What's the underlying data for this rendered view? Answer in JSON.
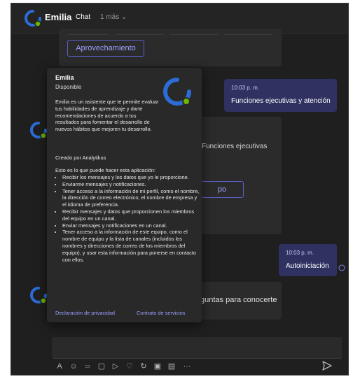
{
  "header": {
    "name": "Emilia",
    "tab": "Chat",
    "more": "1 más"
  },
  "top_card": {
    "button": "Aprovechamiento"
  },
  "messages": [
    {
      "time": "10:03 p. m.",
      "text": "Funciones ejecutivas y atención"
    },
    {
      "time": "10:03 p. m.",
      "text": "Autoiniciación"
    }
  ],
  "mid_card": {
    "text": "Funciones ejecutivas",
    "button_tail": "po"
  },
  "low_card": {
    "text": "guntas para conocerte"
  },
  "popover": {
    "name": "Emilia",
    "status": "Disponible",
    "description": "Emilia es un asistente que te permite evaluar tus habilidades de aprendizaje y darte recomendaciones de acuerdo a tus resultados para fomentar el desarrollo de nuevos hábitos que mejoren tu desarrollo.",
    "created_by": "Creado por Analytikus",
    "intro": "Esto es lo que puede hacer esta aplicación:",
    "bullets": [
      "Recibir los mensajes y los datos que yo le proporcione.",
      "Enviarme mensajes y notificaciones.",
      "Tener acceso a la información de mi perfil, como el nombre, la dirección de correo electrónico, el nombre de empresa y el idioma de preferencia.",
      "Recibir mensajes y datos que proporcionen los miembros del equipo en un canal.",
      "Enviar mensajes y notificaciones en un canal.",
      "Tener acceso a la información de este equipo, como el nombre de equipo y la lista de canales (incluidos los nombres y direcciones de correo de los miembros del equipo), y usar esta información para ponerse en contacto con ellos."
    ],
    "privacy_link": "Declaración de privacidad",
    "terms_link": "Contrato de servicios"
  },
  "toolbar": [
    "format-icon",
    "emoji-icon",
    "gif-icon",
    "sticker-icon",
    "meet-icon",
    "praise-icon",
    "loop-icon",
    "apps-icon",
    "attach-icon",
    "more-icon"
  ],
  "toolbar_more": "···",
  "colors": {
    "accent": "#5b5fc7",
    "message_bg": "#2f3160",
    "available": "#6bb700",
    "background": "#1f1f1f"
  }
}
